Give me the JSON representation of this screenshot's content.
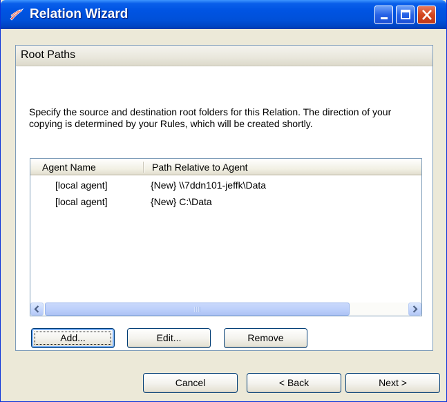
{
  "window": {
    "title": "Relation Wizard",
    "icon": "relation-wizard-app-icon",
    "controls": [
      "minimize-icon",
      "maximize-icon",
      "close-icon"
    ]
  },
  "section": {
    "title": "Root Paths",
    "description": "Specify the source and destination root folders for this Relation. The direction of your copying is determined by your Rules, which will be created shortly."
  },
  "list": {
    "columns": [
      "Agent Name",
      "Path Relative to Agent"
    ],
    "rows": [
      {
        "agent": "[local agent]",
        "path": "{New} \\\\7ddn101-jeffk\\Data"
      },
      {
        "agent": "[local agent]",
        "path": "{New} C:\\Data"
      }
    ]
  },
  "list_buttons": {
    "add": "Add...",
    "edit": "Edit...",
    "remove": "Remove"
  },
  "nav_buttons": {
    "cancel": "Cancel",
    "back": "< Back",
    "next": "Next >"
  },
  "colors": {
    "titlebar": "#0054e3",
    "dialog_bg": "#ece9d8",
    "close_button": "#d3461f",
    "border": "#7f9db9"
  }
}
